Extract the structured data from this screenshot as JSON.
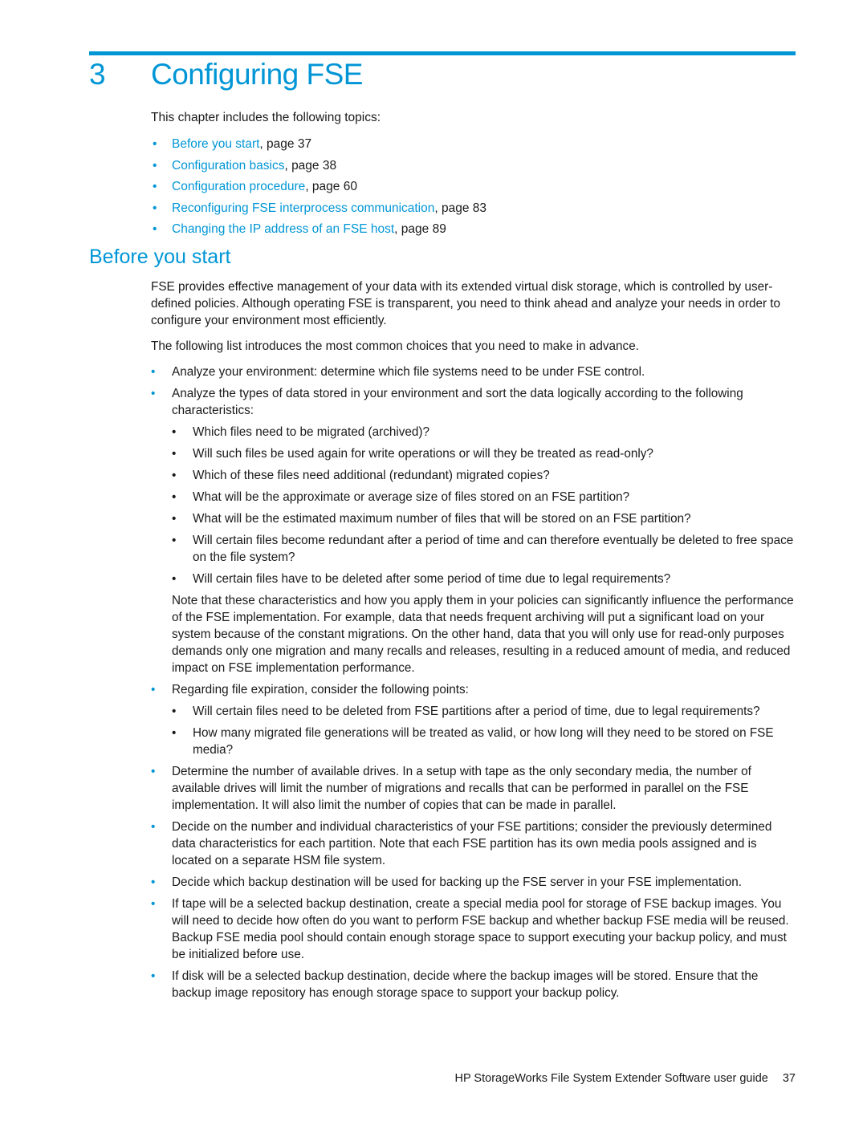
{
  "chapter": {
    "number": "3",
    "title": "Configuring FSE"
  },
  "intro": "This chapter includes the following topics:",
  "topics": [
    {
      "link": "Before you start",
      "suffix": ", page 37"
    },
    {
      "link": "Configuration basics",
      "suffix": ", page 38"
    },
    {
      "link": "Configuration procedure",
      "suffix": ", page 60"
    },
    {
      "link": "Reconfiguring FSE interprocess communication",
      "suffix": ", page 83"
    },
    {
      "link": "Changing the IP address of an FSE host",
      "suffix": ", page 89"
    }
  ],
  "section": {
    "title": "Before you start",
    "para1": "FSE provides effective management of your data with its extended virtual disk storage, which is controlled by user-defined policies. Although operating FSE is transparent, you need to think ahead and analyze your needs in order to configure your environment most efficiently.",
    "para2": "The following list introduces the most common choices that you need to make in advance.",
    "items": [
      {
        "text": "Analyze your environment: determine which file systems need to be under FSE control."
      },
      {
        "text": "Analyze the types of data stored in your environment and sort the data logically according to the following characteristics:",
        "sub": [
          "Which files need to be migrated (archived)?",
          "Will such files be used again for write operations or will they be treated as read-only?",
          "Which of these files need additional (redundant) migrated copies?",
          "What will be the approximate or average size of files stored on an FSE partition?",
          "What will be the estimated maximum number of files that will be stored on an FSE partition?",
          "Will certain files become redundant after a period of time and can therefore eventually be deleted to free space on the file system?",
          "Will certain files have to be deleted after some period of time due to legal requirements?"
        ],
        "note": "Note that these characteristics and how you apply them in your policies can significantly influence the performance of the FSE implementation. For example, data that needs frequent archiving will put a significant load on your system because of the constant migrations. On the other hand, data that you will only use for read-only purposes demands only one migration and many recalls and releases, resulting in a reduced amount of media, and reduced impact on FSE implementation performance."
      },
      {
        "text": "Regarding file expiration, consider the following points:",
        "sub": [
          "Will certain files need to be deleted from FSE partitions after a period of time, due to legal requirements?",
          "How many migrated file generations will be treated as valid, or how long will they need to be stored on FSE media?"
        ]
      },
      {
        "text": "Determine the number of available drives. In a setup with tape as the only secondary media, the number of available drives will limit the number of migrations and recalls that can be performed in parallel on the FSE implementation. It will also limit the number of copies that can be made in parallel."
      },
      {
        "text": "Decide on the number and individual characteristics of your FSE partitions; consider the previously determined data characteristics for each partition. Note that each FSE partition has its own media pools assigned and is located on a separate HSM file system."
      },
      {
        "text": "Decide which backup destination will be used for backing up the FSE server in your FSE implementation."
      },
      {
        "text": "If tape will be a selected backup destination, create a special media pool for storage of FSE backup images. You will need to decide how often do you want to perform FSE backup and whether backup FSE media will be reused. Backup FSE media pool should contain enough storage space to support executing your backup policy, and must be initialized before use."
      },
      {
        "text": "If disk will be a selected backup destination, decide where the backup images will be stored. Ensure that the backup image repository has enough storage space to support your backup policy."
      }
    ]
  },
  "bullet": "•",
  "footer": {
    "text": "HP StorageWorks File System Extender Software user guide",
    "page": "37"
  }
}
